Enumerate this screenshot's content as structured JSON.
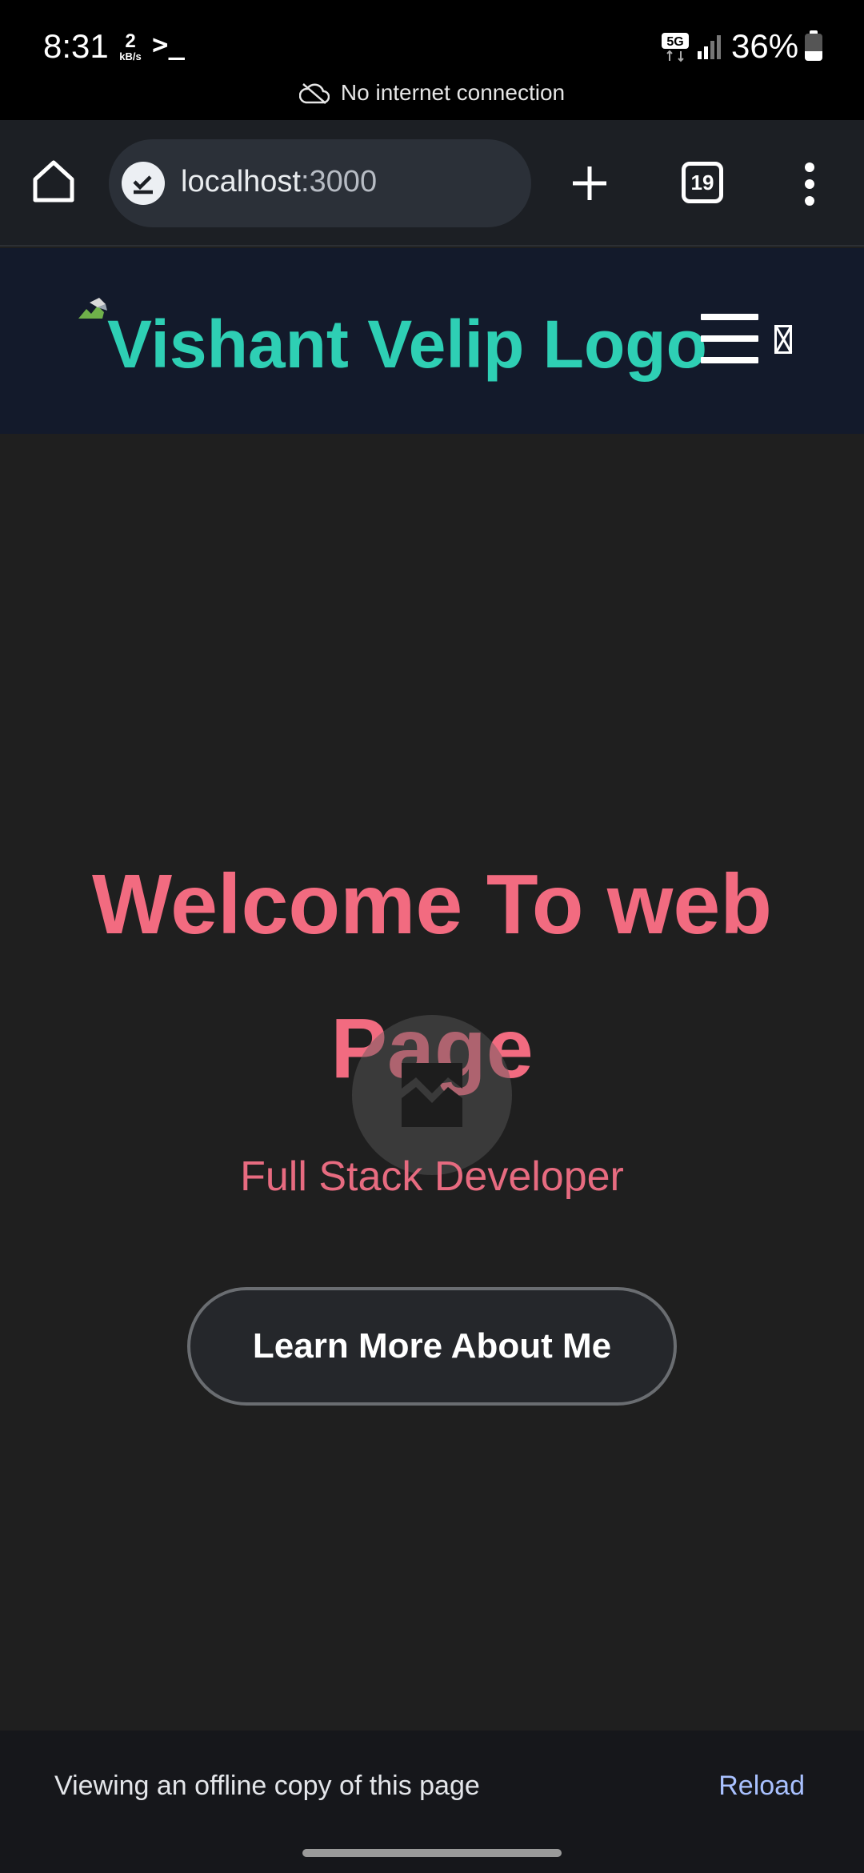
{
  "status_bar": {
    "time": "8:31",
    "speed_value": "2",
    "speed_unit": "kB/s",
    "terminal_glyph": ">_",
    "network": "5G",
    "battery": "36%",
    "battery_level": 0.36
  },
  "connectivity": {
    "message": "No internet connection"
  },
  "browser": {
    "url_host": "localhost",
    "url_port": ":3000",
    "tab_count": "19",
    "icons": [
      "home-icon",
      "site-info-icon",
      "new-tab-icon",
      "tab-switcher-icon",
      "more-menu-icon"
    ]
  },
  "site_header": {
    "logo_alt": "Vishant Velip Logo",
    "menu_icon": "hamburger-icon"
  },
  "hero": {
    "title": "Welcome To web Page",
    "subtitle": "Full Stack Developer",
    "cta_label": "Learn More About Me"
  },
  "offline_banner": {
    "message": "Viewing an offline copy of this page",
    "action": "Reload"
  },
  "colors": {
    "accent_teal": "#2ecfb4",
    "hero_pink": "#f26b80",
    "link_blue": "#a9c1ff"
  }
}
